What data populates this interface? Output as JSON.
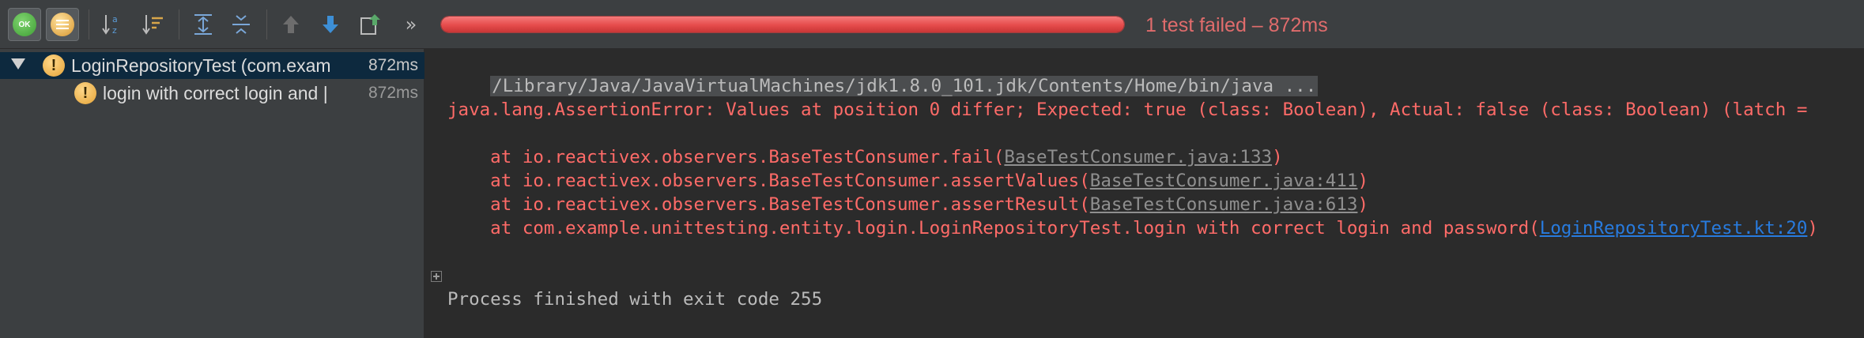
{
  "toolbar": {
    "ok_label": "OK",
    "more_label": "»",
    "progress_fraction": 1.0,
    "progress_color": "#e54b4b",
    "status_text": "1 test failed – 872ms",
    "icons": [
      "show-passed-icon",
      "show-ignored-icon",
      "sort-alphabetically-icon",
      "sort-by-duration-icon",
      "expand-all-icon",
      "collapse-all-icon",
      "previous-failed-icon",
      "next-failed-icon",
      "export-results-icon",
      "more-icon"
    ]
  },
  "tree": {
    "items": [
      {
        "label": "LoginRepositoryTest (com.exam",
        "time": "872ms",
        "status_icon": "warning-icon",
        "expanded": true
      },
      {
        "label": "login with correct login and |",
        "time": "872ms",
        "status_icon": "warning-icon"
      }
    ]
  },
  "console": {
    "command": "/Library/Java/JavaVirtualMachines/jdk1.8.0_101.jdk/Contents/Home/bin/java ...",
    "error": "java.lang.AssertionError: Values at position 0 differ; Expected: true (class: Boolean), Actual: false (class: Boolean) (latch = ",
    "stack": [
      {
        "prefix": "    at io.reactivex.observers.BaseTestConsumer.fail(",
        "link": "BaseTestConsumer.java:133",
        "suffix": ")",
        "link_type": "gray"
      },
      {
        "prefix": "    at io.reactivex.observers.BaseTestConsumer.assertValues(",
        "link": "BaseTestConsumer.java:411",
        "suffix": ")",
        "link_type": "gray"
      },
      {
        "prefix": "    at io.reactivex.observers.BaseTestConsumer.assertResult(",
        "link": "BaseTestConsumer.java:613",
        "suffix": ")",
        "link_type": "gray"
      },
      {
        "prefix": "    at com.example.unittesting.entity.login.LoginRepositoryTest.login with correct login and password(",
        "link": "LoginRepositoryTest.kt:20",
        "suffix": ")",
        "link_type": "blue"
      }
    ],
    "exit": "Process finished with exit code 255"
  },
  "colors": {
    "error": "#ff6b68",
    "gray_link": "#8f8f8f",
    "blue_link": "#287bde",
    "selection": "#0d293e",
    "background": "#2b2b2b",
    "panel": "#3c3f41"
  }
}
